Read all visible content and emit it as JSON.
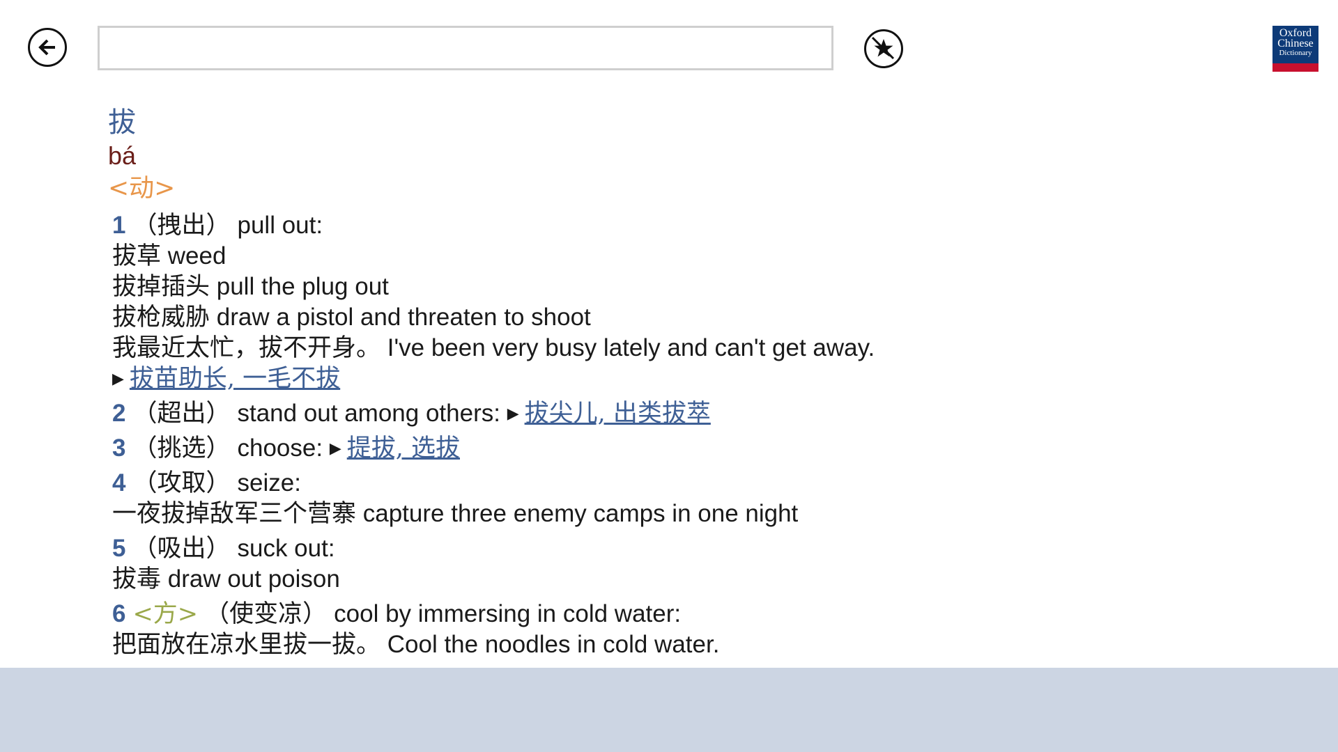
{
  "search": {
    "value": "",
    "placeholder": ""
  },
  "logo": {
    "line1": "Oxford",
    "line2": "Chinese",
    "line3": "Dictionary"
  },
  "entry": {
    "headword": "拔",
    "pinyin": "bá",
    "pos": "<动>",
    "senses": [
      {
        "num": "1",
        "gloss_cn": "（拽出）",
        "gloss_en": "pull out:",
        "examples": [
          {
            "cn": "拔草",
            "en": "weed"
          },
          {
            "cn": "拔掉插头",
            "en": "pull the plug out"
          },
          {
            "cn": "拔枪威胁",
            "en": "draw a pistol and threaten to shoot"
          },
          {
            "cn": "我最近太忙，拔不开身。",
            "en": "I've been very busy lately and can't get away."
          }
        ],
        "idioms": "拔苗助长, 一毛不拔"
      },
      {
        "num": "2",
        "gloss_cn": "（超出）",
        "gloss_en": "stand out among others:",
        "xref": "拔尖儿, 出类拔萃"
      },
      {
        "num": "3",
        "gloss_cn": "（挑选）",
        "gloss_en": "choose:",
        "xref": "提拔, 选拔"
      },
      {
        "num": "4",
        "gloss_cn": "（攻取）",
        "gloss_en": "seize:",
        "examples": [
          {
            "cn": "一夜拔掉敌军三个营寨",
            "en": "capture three enemy camps in one night"
          }
        ]
      },
      {
        "num": "5",
        "gloss_cn": "（吸出）",
        "gloss_en": "suck out:",
        "examples": [
          {
            "cn": "拔毒",
            "en": "draw out poison"
          }
        ]
      },
      {
        "num": "6",
        "register": "<方>",
        "gloss_cn": "（使变凉）",
        "gloss_en": "cool by immersing in cold water:",
        "examples": [
          {
            "cn": "把面放在凉水里拔一拔。",
            "en": "Cool the noodles in cold water."
          }
        ]
      }
    ]
  },
  "icons": {
    "back": "back-arrow-icon",
    "favorite": "favorite-star-icon",
    "xref_marker": "triangle-right-icon"
  },
  "colors": {
    "headword": "#3e5f95",
    "pinyin": "#6b1f1a",
    "pos": "#e8964a",
    "register": "#9aa84a",
    "link": "#3e5f95",
    "footer": "#ccd5e3"
  }
}
